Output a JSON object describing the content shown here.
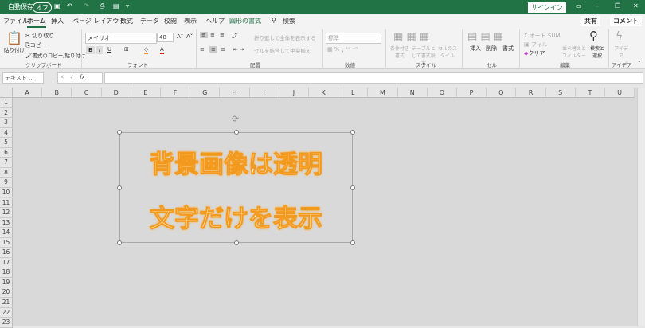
{
  "titlebar": {
    "autosave": "自動保存",
    "autosave_state": "オフ",
    "signin": "サインイン",
    "more": "▿"
  },
  "tabs": [
    "ファイル",
    "ホーム",
    "挿入",
    "ページ レイアウト",
    "数式",
    "データ",
    "校閲",
    "表示",
    "ヘルプ",
    "図形の書式"
  ],
  "search": "検索",
  "share": "共有",
  "comment": "コメント",
  "ribbon": {
    "clipboard": {
      "paste": "貼り付け",
      "cut": "切り取り",
      "copy": "コピー",
      "format_painter": "書式のコピー/貼り付け",
      "label": "クリップボード"
    },
    "font": {
      "name": "メイリオ",
      "size": "48",
      "label": "フォント"
    },
    "alignment": {
      "wrap": "折り返して全体を表示する",
      "merge": "セルを結合して中央揃え",
      "label": "配置"
    },
    "number": {
      "format": "標準",
      "label": "数値"
    },
    "styles": {
      "conditional": "条件付き書式",
      "table": "テーブルとして書式設定",
      "cell": "セルのスタイル",
      "label": "スタイル"
    },
    "cells": {
      "insert": "挿入",
      "delete": "削除",
      "format": "書式",
      "label": "セル"
    },
    "editing": {
      "autosum": "オート SUM",
      "fill": "フィル",
      "clear": "クリア",
      "sort": "並べ替えとフィルター",
      "find": "検索と選択",
      "label": "編集"
    },
    "ideas": {
      "ideas": "アイデア",
      "label": "アイデア"
    }
  },
  "namebox": "テキスト ...",
  "fx": "fx",
  "columns": [
    "A",
    "B",
    "C",
    "D",
    "E",
    "F",
    "G",
    "H",
    "I",
    "J",
    "K",
    "L",
    "M",
    "N",
    "O",
    "P",
    "Q",
    "R",
    "S",
    "T",
    "U"
  ],
  "rows": [
    "1",
    "2",
    "3",
    "4",
    "5",
    "6",
    "7",
    "8",
    "9",
    "10",
    "11",
    "12",
    "13",
    "14",
    "15",
    "16",
    "17",
    "18",
    "19",
    "20",
    "21",
    "22",
    "23"
  ],
  "shape": {
    "line1": "背景画像は透明",
    "line2": "文字だけを表示"
  },
  "colors": {
    "accent": "#217346",
    "text_outline": "#f39a1e"
  }
}
